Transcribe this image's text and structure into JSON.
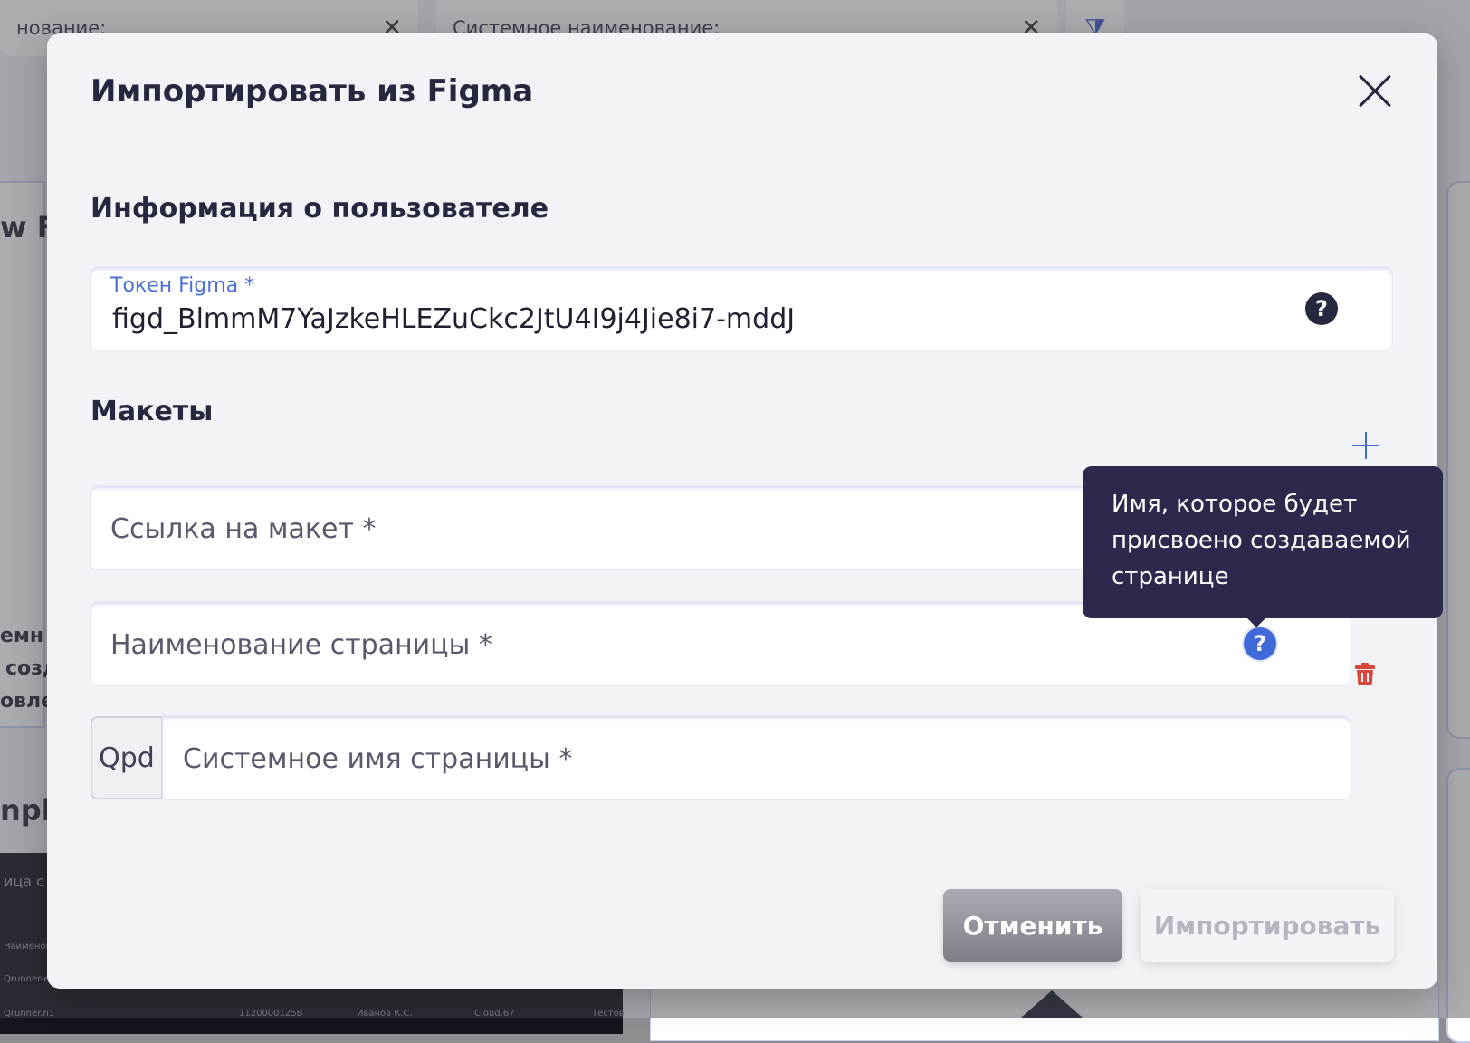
{
  "background": {
    "chip_left_text": "нование:",
    "chip_right_text": "Системное наименование:",
    "close_glyph": "✕",
    "filter_glyph": "⧩",
    "left_text_1": "w Fo",
    "left_text_2": "емн",
    "left_text_3": "созд",
    "left_text_4": "овлен",
    "left_text_5": "npla",
    "dark_caption": "ица с",
    "dark_row_1": "Наименов",
    "dark_row_2": "Qrunner-e",
    "dark_row_3": "Qrunner.n1",
    "dark_row_4_a": "1120000125B",
    "dark_row_4_b": "Иванов К.С.",
    "dark_row_4_c": "Cloud.67",
    "dark_row_4_d": "Тестов"
  },
  "modal": {
    "title": "Импортировать из Figma",
    "user_section": {
      "title": "Информация о пользователе",
      "token_label": "Токен Figma *",
      "token_value": "figd_BlmmM7YaJzkeHLEZuCkc2JtU4I9j4Jie8i7-mddJ"
    },
    "layouts_section": {
      "title": "Макеты",
      "layout_link_placeholder": "Ссылка на макет *",
      "page_name_placeholder": "Наименование страницы *",
      "system_prefix": "Qpd",
      "system_name_placeholder": "Системное имя страницы *"
    },
    "tooltip_text": "Имя, которое будет присвоено создаваемой странице",
    "help_glyph": "?",
    "buttons": {
      "cancel": "Отменить",
      "import": "Импортировать"
    }
  },
  "colors": {
    "accent": "#3f6ad8",
    "title": "#262840",
    "tooltip_bg": "#2b2a4c",
    "danger": "#d9463a"
  }
}
